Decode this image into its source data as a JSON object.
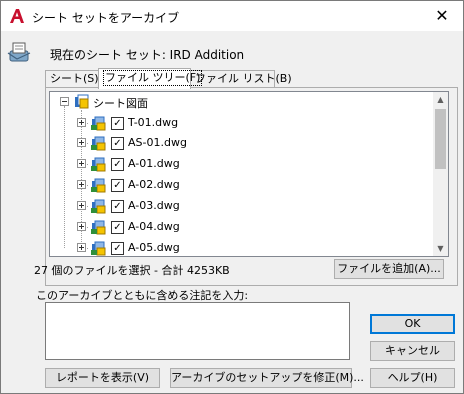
{
  "window": {
    "title": "シート セットをアーカイブ",
    "close_glyph": "✕"
  },
  "header": {
    "current_sheet_set": "現在のシート セット: IRD Addition"
  },
  "tabs": [
    {
      "label": "シート(S)"
    },
    {
      "label": "ファイル ツリー(F)",
      "active": true
    },
    {
      "label": "ファイル リスト(B)"
    }
  ],
  "tree": {
    "root": {
      "label": "シート図面",
      "icon": "sheet-set-icon",
      "expanded": true
    },
    "items": [
      {
        "label": "T-01.dwg",
        "checked": true
      },
      {
        "label": "AS-01.dwg",
        "checked": true
      },
      {
        "label": "A-01.dwg",
        "checked": true
      },
      {
        "label": "A-02.dwg",
        "checked": true
      },
      {
        "label": "A-03.dwg",
        "checked": true
      },
      {
        "label": "A-04.dwg",
        "checked": true
      },
      {
        "label": "A-05.dwg",
        "checked": true
      }
    ],
    "check_glyph": "✓",
    "scroll_up_glyph": "▲",
    "scroll_down_glyph": "▼"
  },
  "status": {
    "text": "27 個のファイルを選択 - 合計 4253KB"
  },
  "buttons": {
    "add_file": "ファイルを追加(A)...",
    "ok": "OK",
    "cancel": "キャンセル",
    "view_report": "レポートを表示(V)",
    "modify_setup": "アーカイブのセットアップを修正(M)...",
    "help": "ヘルプ(H)"
  },
  "notes": {
    "label": "このアーカイブとともに含める注記を入力:",
    "value": ""
  },
  "colors": {
    "accent": "#0078d7",
    "autocad_red": "#c8102e"
  }
}
